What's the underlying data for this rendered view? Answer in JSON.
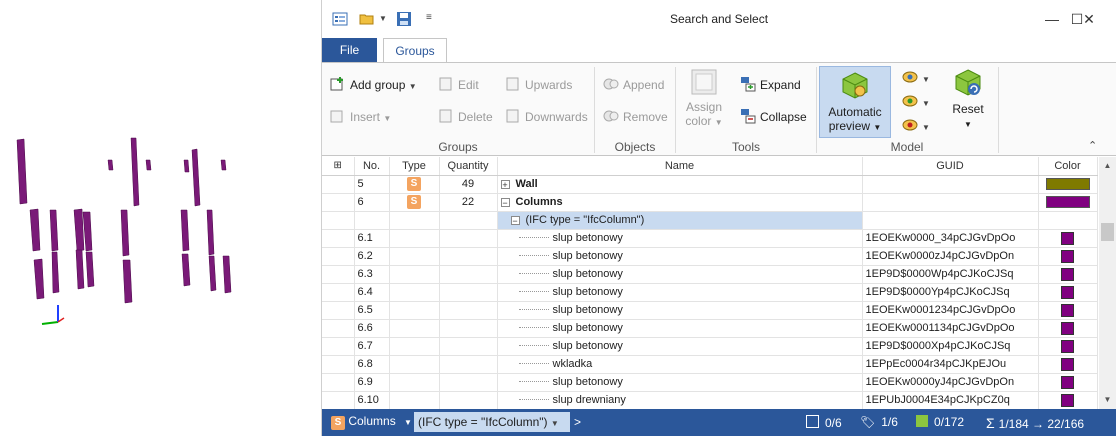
{
  "window": {
    "title": "Search and Select",
    "minimize_icon": "minimize-icon",
    "maximize_icon": "maximize-icon",
    "close_icon": "close-icon"
  },
  "tabs": [
    {
      "label": "File"
    },
    {
      "label": "Groups"
    }
  ],
  "ribbon": {
    "groups_group": {
      "label": "Groups",
      "add_group": "Add group",
      "insert": "Insert",
      "edit": "Edit",
      "delete": "Delete",
      "upwards": "Upwards",
      "downwards": "Downwards"
    },
    "objects_group": {
      "label": "Objects",
      "append": "Append",
      "remove": "Remove"
    },
    "tools_group": {
      "label": "Tools",
      "assign_color_1": "Assign",
      "assign_color_2": "color",
      "expand": "Expand",
      "collapse": "Collapse"
    },
    "model_group": {
      "label": "Model",
      "auto_preview_1": "Automatic",
      "auto_preview_2": "preview",
      "reset": "Reset"
    }
  },
  "grid": {
    "columns": [
      "No.",
      "Type",
      "Quantity",
      "Name",
      "GUID",
      "Color"
    ],
    "groups": [
      {
        "no": "5",
        "type": "S",
        "quantity": "49",
        "name": "Wall",
        "color": "#7f7a00",
        "expanded": false
      },
      {
        "no": "6",
        "type": "S",
        "quantity": "22",
        "name": "Columns",
        "color": "#800080",
        "expanded": true
      }
    ],
    "filter_label": "(IFC type = \"IfcColumn\")",
    "rows": [
      {
        "no": "6.1",
        "name": "slup betonowy",
        "guid": "1EOEKw0000_34pCJGvDpOo"
      },
      {
        "no": "6.2",
        "name": "slup betonowy",
        "guid": "1EOEKw0000zJ4pCJGvDpOn"
      },
      {
        "no": "6.3",
        "name": "slup betonowy",
        "guid": "1EP9D$0000Wp4pCJKoCJSq"
      },
      {
        "no": "6.4",
        "name": "slup betonowy",
        "guid": "1EP9D$0000Yp4pCJKoCJSq"
      },
      {
        "no": "6.5",
        "name": "slup betonowy",
        "guid": "1EOEKw0001234pCJGvDpOo"
      },
      {
        "no": "6.6",
        "name": "slup betonowy",
        "guid": "1EOEKw0001134pCJGvDpOo"
      },
      {
        "no": "6.7",
        "name": "slup betonowy",
        "guid": "1EP9D$0000Xp4pCJKoCJSq"
      },
      {
        "no": "6.8",
        "name": "wkladka",
        "guid": "1EPpEc0004r34pCJKpEJOu"
      },
      {
        "no": "6.9",
        "name": "slup betonowy",
        "guid": "1EOEKw0000yJ4pCJGvDpOn"
      },
      {
        "no": "6.10",
        "name": "slup drewniany",
        "guid": "1EPUbJ0004E34pCJKpCZ0q"
      }
    ],
    "row_color": "#800080"
  },
  "statusbar": {
    "group_label": "Columns",
    "filter_label": "(IFC type = \"IfcColumn\")",
    "arrow": ">",
    "selected": "0/6",
    "tagged": "1/6",
    "visible": "0/172",
    "total": "1/184 → 22/166"
  }
}
